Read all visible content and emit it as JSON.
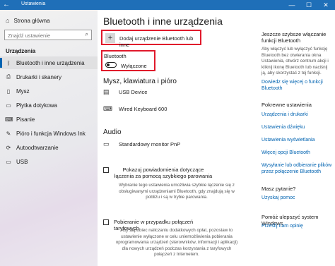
{
  "window": {
    "back_icon": "back-arrow-icon",
    "title": "Ustawienia",
    "min": "—",
    "max": "☐",
    "close": "✕"
  },
  "sidebar": {
    "home_label": "Strona główna",
    "search_placeholder": "Znajdź ustawienie",
    "section": "Urządzenia",
    "items": [
      {
        "label": "Bluetooth i inne urządzenia",
        "icon": "bluetooth-icon"
      },
      {
        "label": "Drukarki i skanery",
        "icon": "printer-icon"
      },
      {
        "label": "Mysz",
        "icon": "mouse-icon"
      },
      {
        "label": "Płytka dotykowa",
        "icon": "touchpad-icon"
      },
      {
        "label": "Pisanie",
        "icon": "keyboard-icon"
      },
      {
        "label": "Pióro i funkcja Windows Ink",
        "icon": "pen-icon"
      },
      {
        "label": "Autoodtwarzanie",
        "icon": "autoplay-icon"
      },
      {
        "label": "USB",
        "icon": "usb-icon"
      }
    ]
  },
  "main": {
    "title": "Bluetooth i inne urządzenia",
    "add_device_label": "Dodaj urządzenie Bluetooth lub inne",
    "bluetooth_label": "Bluetooth",
    "bluetooth_state": "Wyłączone",
    "bluetooth_on": false,
    "group1_title": "Mysz, klawiatura i pióro",
    "group1_devices": [
      {
        "name": "USB Device",
        "icon": "usb-device-icon"
      },
      {
        "name": "Wired Keyboard 600",
        "icon": "keyboard-icon"
      }
    ],
    "group2_title": "Audio",
    "group2_devices": [
      {
        "name": "Standardowy monitor PnP",
        "icon": "monitor-icon"
      }
    ],
    "swift_pair_label": "Pokazuj powiadomienia dotyczące łączenia za pomocą szybkiego parowania",
    "swift_pair_desc": "Wybranie tego ustawienia umożliwia szybkie łączenie się z obsługiwanymi urządzeniami Bluetooth, gdy znajdują się w pobliżu i są w trybie parowania.",
    "metered_label": "Pobieranie w przypadku połączeń taryfowych",
    "metered_desc": "Aby zapobiec naliczaniu dodatkowych opłat, pozostaw to ustawienie wyłączone w celu uniemożliwienia pobierania oprogramowania urządzeń (sterowników, informacji i aplikacji) dla nowych urządzeń podczas korzystania z taryfowych połączeń z Internetem."
  },
  "right": {
    "tip_title": "Jeszcze szybsze włączanie funkcji Bluetooth",
    "tip_text": "Aby włączyć lub wyłączyć funkcję Bluetooth bez otwierania okna Ustawienia, otwórz centrum akcji i kliknij ikonę Bluetooth lub naciśnij ją, aby skorzystać z tej funkcji.",
    "tip_link": "Dowiedz się więcej o funkcji Bluetooth",
    "related_title": "Pokrewne ustawienia",
    "related_links": [
      "Urządzenia i drukarki",
      "Ustawienia dźwięku",
      "Ustawienia wyświetlania",
      "Więcej opcji Bluetooth",
      "Wysyłanie lub odbieranie plików przez połączenie Bluetooth"
    ],
    "help_title": "Masz pytanie?",
    "help_link": "Uzyskaj pomoc",
    "improve_title": "Pomóż ulepszyć system Windows",
    "improve_link": "Prześlij nam opinię"
  },
  "colors": {
    "accent": "#0063b1",
    "titlebar": "#1f6fb8",
    "highlight_border": "#e0192b"
  }
}
